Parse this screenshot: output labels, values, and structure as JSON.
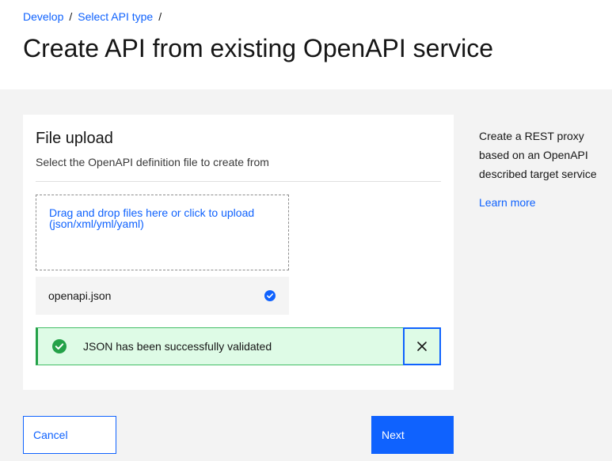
{
  "breadcrumb": {
    "items": [
      "Develop",
      "Select API type"
    ],
    "separator": "/"
  },
  "page": {
    "title": "Create API from existing OpenAPI service"
  },
  "upload_panel": {
    "title": "File upload",
    "subtitle": "Select the OpenAPI definition file to create from",
    "dropzone": {
      "line1": "Drag and drop files here or click to upload",
      "line2": "(json/xml/yml/yaml)"
    },
    "file": {
      "name": "openapi.json",
      "status_icon": "checkmark-filled-icon"
    },
    "notification": {
      "kind": "success",
      "message": "JSON has been successfully validated",
      "icon": "checkmark-filled-icon",
      "close_icon": "close-icon"
    }
  },
  "side_info": {
    "description": "Create a REST proxy based on an OpenAPI described target service",
    "link": "Learn more"
  },
  "actions": {
    "cancel_label": "Cancel",
    "next_label": "Next"
  },
  "colors": {
    "primary": "#0f62fe",
    "success": "#24a148",
    "success_bg": "#defbe6",
    "page_bg": "#f3f3f3"
  }
}
